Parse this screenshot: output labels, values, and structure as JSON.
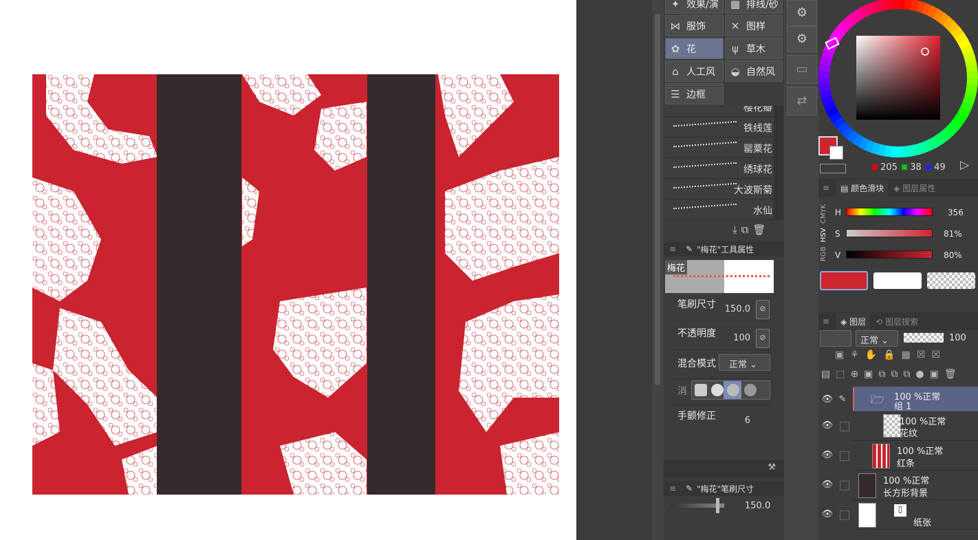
{
  "categories": [
    {
      "label": "效果/演",
      "icon": "effect-icon"
    },
    {
      "label": "排线/砂",
      "icon": "hatch-icon"
    },
    {
      "label": "服饰",
      "icon": "ribbon-icon"
    },
    {
      "label": "图样",
      "icon": "pattern-icon"
    },
    {
      "label": "花",
      "icon": "flower-icon",
      "selected": true
    },
    {
      "label": "草木",
      "icon": "grass-icon"
    },
    {
      "label": "人工风",
      "icon": "house-icon"
    },
    {
      "label": "自然风",
      "icon": "rock-icon"
    },
    {
      "label": "边框",
      "icon": "frame-icon"
    }
  ],
  "brushes": [
    "樱花瓣",
    "铁线莲",
    "罂粟花",
    "绣球花",
    "大波斯菊",
    "水仙"
  ],
  "tool_property": {
    "title": "\"梅花\"工具属性",
    "brush_name": "梅花",
    "size_label": "笔刷尺寸",
    "size_value": "150.0",
    "opacity_label": "不透明度",
    "opacity_value": "100",
    "blend_label": "混合模式",
    "blend_value": "正常",
    "aa_label": "消",
    "stabilizer_label": "手颤修正",
    "stabilizer_value": "6"
  },
  "brush_size_panel": {
    "title": "\"梅花\"笔刷尺寸",
    "value": "150.0"
  },
  "color": {
    "main": "#cd2631",
    "sub": "#ffffff",
    "r": "205",
    "g": "38",
    "b": "49",
    "tabs": [
      "颜色滑块",
      "图层属性"
    ],
    "mode_tabs": [
      "RGB",
      "HSV",
      "CMYK"
    ],
    "h_label": "H",
    "h_value": "356",
    "s_label": "S",
    "s_value": "81%",
    "v_label": "V",
    "v_value": "80%"
  },
  "layers_panel": {
    "tabs": [
      "图层",
      "图层搜索"
    ],
    "blend_mode": "正常",
    "opacity": "100",
    "layers": [
      {
        "opacity": "100 %正常",
        "name": "组 1",
        "type": "folder"
      },
      {
        "opacity": "100 %正常",
        "name": "花纹",
        "type": "raster"
      },
      {
        "opacity": "100 %正常",
        "name": "红条",
        "type": "raster"
      },
      {
        "opacity": "100 %正常",
        "name": "长方形背景",
        "type": "raster"
      },
      {
        "opacity": "",
        "name": "纸张",
        "type": "paper"
      }
    ]
  }
}
